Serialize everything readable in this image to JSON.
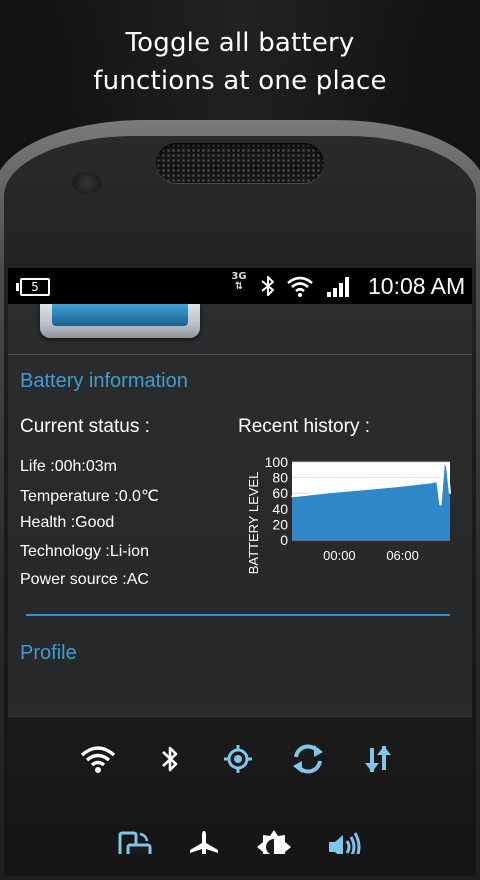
{
  "promo": {
    "line1": "Toggle all battery",
    "line2": "functions at one place"
  },
  "statusbar": {
    "battery_level": "5",
    "network": "3G",
    "time": "10:08 AM"
  },
  "battery_info": {
    "section_title": "Battery information",
    "current_status_heading": "Current status :",
    "recent_history_heading": "Recent history :",
    "lines": [
      "Life :00h:03m",
      "Temperature :0.0℃",
      "Health :Good",
      "Technology :Li-ion",
      "Power source :AC"
    ]
  },
  "profile": {
    "section_title": "Profile"
  },
  "quick_toggles": [
    {
      "name": "wifi-toggle-icon",
      "active": true
    },
    {
      "name": "bluetooth-toggle-icon",
      "active": false
    },
    {
      "name": "gps-toggle-icon",
      "active": true
    },
    {
      "name": "sync-toggle-icon",
      "active": true
    },
    {
      "name": "mobile-data-toggle-icon",
      "active": true
    },
    {
      "name": "auto-rotate-toggle-icon",
      "active": true
    },
    {
      "name": "airplane-mode-toggle-icon",
      "active": false
    },
    {
      "name": "brightness-toggle-icon",
      "active": false
    },
    {
      "name": "sound-toggle-icon",
      "active": true
    }
  ],
  "colors": {
    "accent": "#3d9dd0",
    "chart_fill": "#2f86c8"
  },
  "chart_data": {
    "type": "area",
    "title": "Recent history :",
    "ylabel": "BATTERY LEVEL",
    "xlabel": "",
    "yticks": [
      "100",
      "80",
      "60",
      "40",
      "20",
      "0"
    ],
    "xticks": [
      "00:00",
      "06:00"
    ],
    "ylim": [
      0,
      100
    ],
    "series": [
      {
        "x": [
          0,
          0.22,
          0.44,
          0.66,
          0.88,
          0.92,
          0.94,
          0.96,
          0.98,
          1.0
        ],
        "values": [
          56,
          61,
          65,
          69,
          74,
          76,
          45,
          97,
          97,
          60
        ]
      }
    ]
  }
}
